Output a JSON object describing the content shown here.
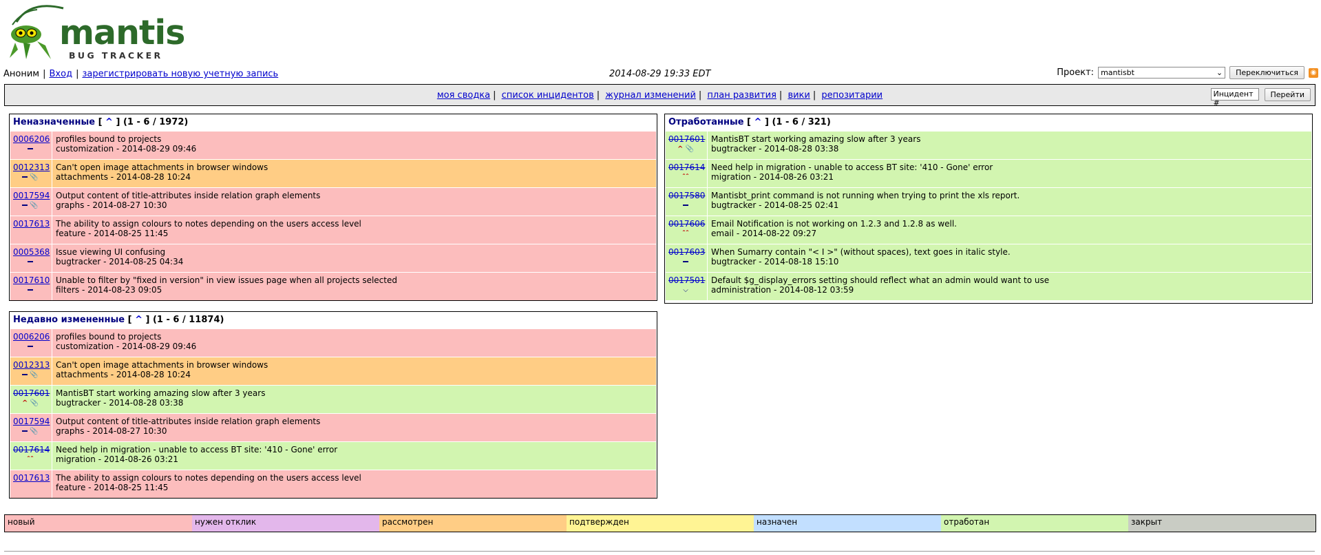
{
  "logo": {
    "word": "mantis",
    "sub": "BUG TRACKER"
  },
  "login": {
    "user": "Аноним",
    "login_link": "Вход",
    "register_link": "зарегистрировать новую учетную запись",
    "time": "2014-08-29 19:33 EDT",
    "project_label": "Проект:",
    "project_value": "mantisbt",
    "switch_btn": "Переключиться"
  },
  "menu": {
    "items": [
      "моя сводка",
      "список инцидентов",
      "журнал изменений",
      "план развития",
      "вики",
      "репозитарии"
    ],
    "jump_placeholder": "Инцидент #",
    "jump_btn": "Перейти"
  },
  "unassigned": {
    "title": "Неназначенные",
    "range": "(1 - 6 / 1972)",
    "rows": [
      {
        "id": "0006206",
        "summary": "profiles bound to projects",
        "meta": "customization - 2014-08-29 09:46"
      },
      {
        "id": "0012313",
        "summary": "Can't open image attachments in browser windows",
        "meta": "attachments - 2014-08-28 10:24"
      },
      {
        "id": "0017594",
        "summary": "Output content of title-attributes inside relation graph elements",
        "meta": "graphs - 2014-08-27 10:30"
      },
      {
        "id": "0017613",
        "summary": "The ability to assign colours to notes depending on the users access level",
        "meta": "feature - 2014-08-25 11:45"
      },
      {
        "id": "0005368",
        "summary": "Issue viewing UI confusing",
        "meta": "bugtracker - 2014-08-25 04:34"
      },
      {
        "id": "0017610",
        "summary": "Unable to filter by \"fixed in version\" in view issues page when all projects selected",
        "meta": "filters - 2014-08-23 09:05"
      }
    ]
  },
  "resolved": {
    "title": "Отработанные",
    "range": "(1 - 6 / 321)",
    "rows": [
      {
        "id": "0017601",
        "summary": "MantisBT start working amazing slow after 3 years",
        "meta": "bugtracker - 2014-08-28 03:38"
      },
      {
        "id": "0017614",
        "summary": "Need help in migration - unable to access BT site: '410 - Gone' error",
        "meta": "migration - 2014-08-26 03:21"
      },
      {
        "id": "0017580",
        "summary": "Mantisbt_print command is not running when trying to print the xls report.",
        "meta": "bugtracker - 2014-08-25 02:41"
      },
      {
        "id": "0017606",
        "summary": "Email Notification is not working on 1.2.3 and 1.2.8 as well.",
        "meta": "email - 2014-08-22 09:27"
      },
      {
        "id": "0017603",
        "summary": "When Sumarry contain \"< I >\" (without spaces), text goes in italic style.",
        "meta": "bugtracker - 2014-08-18 15:10"
      },
      {
        "id": "0017501",
        "summary": "Default $g_display_errors setting should reflect what an admin would want to use",
        "meta": "administration - 2014-08-12 03:59"
      }
    ]
  },
  "recent": {
    "title": "Недавно измененные",
    "range": "(1 - 6 / 11874)",
    "rows": [
      {
        "id": "0006206",
        "summary": "profiles bound to projects",
        "meta": "customization - 2014-08-29 09:46"
      },
      {
        "id": "0012313",
        "summary": "Can't open image attachments in browser windows",
        "meta": "attachments - 2014-08-28 10:24"
      },
      {
        "id": "0017601",
        "summary": "MantisBT start working amazing slow after 3 years",
        "meta": "bugtracker - 2014-08-28 03:38"
      },
      {
        "id": "0017594",
        "summary": "Output content of title-attributes inside relation graph elements",
        "meta": "graphs - 2014-08-27 10:30"
      },
      {
        "id": "0017614",
        "summary": "Need help in migration - unable to access BT site: '410 - Gone' error",
        "meta": "migration - 2014-08-26 03:21"
      },
      {
        "id": "0017613",
        "summary": "The ability to assign colours to notes depending on the users access level",
        "meta": "feature - 2014-08-25 11:45"
      }
    ]
  },
  "legend": [
    "новый",
    "нужен отклик",
    "рассмотрен",
    "подтвержден",
    "назначен",
    "отработан",
    "закрыт"
  ],
  "colors": {
    "new": "#fcbdbd",
    "feedback": "#e3b7eb",
    "acknowledged": "#ffcd85",
    "confirmed": "#fff494",
    "assigned": "#c2dfff",
    "resolved": "#d2f5b0",
    "closed": "#c9ccc4"
  }
}
